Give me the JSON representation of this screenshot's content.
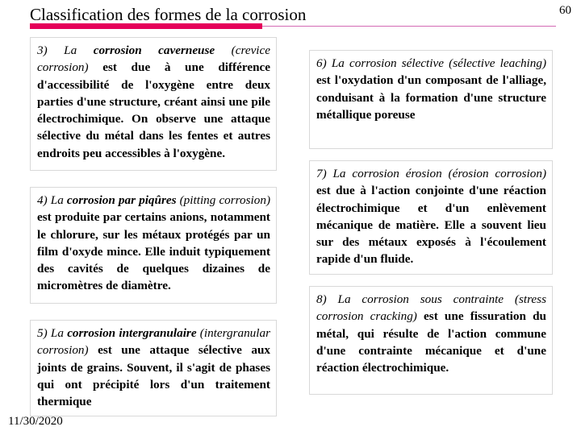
{
  "slide": {
    "number": "60",
    "title": "Classification des formes de la corrosion",
    "footer_date": "11/30/2020",
    "accent_color_thick": "#e5005a",
    "accent_color_thin": "#d46ab4",
    "background_color": "#ffffff",
    "box_border_color": "#d9d9d9"
  },
  "content_boxes": [
    {
      "id": "box-3",
      "column": "left",
      "number": "3)",
      "lead_italic": "3) La ",
      "term_bold_italic": "corrosion caverneuse",
      "english_italic": " (crevice corrosion)",
      "body": " est due à une différence d'accessibilité de l'oxygène entre deux parties d'une structure, créant ainsi une pile électrochimique. On observe une attaque sélective du métal dans les fentes et autres endroits peu accessibles à l'oxygène.",
      "full_text": "3) La corrosion caverneuse (crevice corrosion) est due à une différence d'accessibilité de l'oxygène entre deux parties d'une structure, créant ainsi une pile électrochimique. On observe une attaque sélective du métal dans les fentes et autres endroits peu accessibles à l'oxygène."
    },
    {
      "id": "box-4",
      "column": "left",
      "number": "4)",
      "lead_italic": "4) La ",
      "term_bold_italic": "corrosion par piqûres",
      "english_italic": " (pitting corrosion)",
      "body": " est produite par certains anions, notamment le chlorure, sur les métaux protégés par un film d'oxyde mince. Elle induit typiquement des cavités de quelques dizaines de micromètres de diamètre.",
      "full_text": "4) La corrosion par piqûres (pitting corrosion) est produite par certains anions, notamment le chlorure, sur les métaux protégés par un film d'oxyde mince. Elle induit typiquement des cavités de quelques dizaines de micromètres de diamètre."
    },
    {
      "id": "box-5",
      "column": "left",
      "number": "5)",
      "lead_italic": "5) La ",
      "term_bold_italic": "corrosion intergranulaire",
      "english_italic": " (intergranular corrosion)",
      "body": " est une attaque sélective aux joints de grains. Souvent, il s'agit de phases qui ont précipité lors d'un traitement thermique",
      "full_text": "5) La corrosion intergranulaire (intergranular corrosion) est une attaque sélective aux joints de grains. Souvent, il s'agit de phases qui ont précipité lors d'un traitement thermique"
    },
    {
      "id": "box-6",
      "column": "right",
      "number": "6)",
      "lead_italic": "6) La corrosion sélective (sélective leaching)",
      "term_bold_italic": "",
      "english_italic": "",
      "body": " est l'oxydation d'un composant de l'alliage, conduisant à la formation d'une structure métallique poreuse",
      "full_text": "6) La corrosion sélective (sélective leaching) est l'oxydation d'un composant de l'alliage, conduisant à la formation d'une structure métallique poreuse"
    },
    {
      "id": "box-7",
      "column": "right",
      "number": "7)",
      "lead_italic": "7) La corrosion érosion (érosion corrosion)",
      "term_bold_italic": "",
      "english_italic": "",
      "body": " est due à l'action conjointe d'une réaction électrochimique et d'un enlèvement mécanique de matière. Elle a souvent lieu sur des métaux exposés à l'écoulement rapide d'un fluide.",
      "full_text": "7) La corrosion érosion (érosion corrosion) est due à l'action conjointe d'une réaction électrochimique et d'un enlèvement mécanique de matière. Elle a souvent lieu sur des métaux exposés à l'écoulement rapide d'un fluide."
    },
    {
      "id": "box-8",
      "column": "right",
      "number": "8)",
      "lead_italic": "8) La corrosion sous contrainte (stress corrosion cracking)",
      "term_bold_italic": "",
      "english_italic": "",
      "body": " est une fissuration du métal, qui résulte de l'action commune d'une contrainte mécanique et d'une réaction électrochimique.",
      "full_text": "8) La corrosion sous contrainte (stress corrosion cracking) est une fissuration du métal, qui résulte de l'action commune d'une contrainte mécanique et d'une réaction électrochimique."
    }
  ]
}
